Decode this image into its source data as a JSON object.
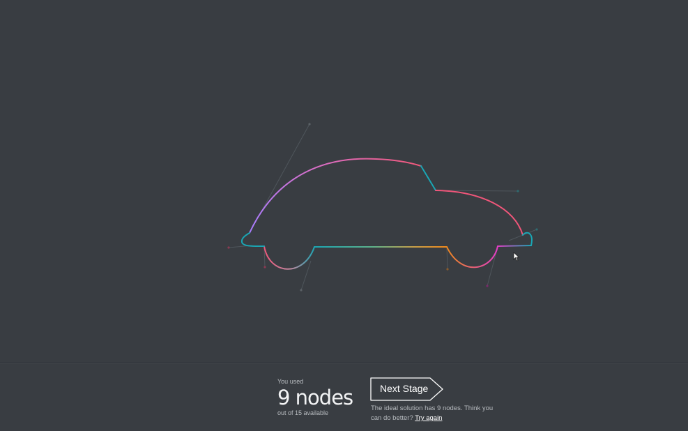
{
  "result": {
    "used_label": "You used",
    "nodes_count": 9,
    "nodes_unit": "nodes",
    "available_label": "out of 15 available"
  },
  "next_button": {
    "label": "Next Stage"
  },
  "hint": {
    "text": "The ideal solution has 9 nodes. Think you can do better?",
    "try_again_label": "Try again"
  },
  "colors": {
    "background": "#393d42",
    "pink": "#f0567a",
    "teal": "#1aa6b4",
    "purple": "#b87bff",
    "orange": "#f08a1c",
    "magenta": "#e43dc7",
    "handle": "#4f565c"
  }
}
